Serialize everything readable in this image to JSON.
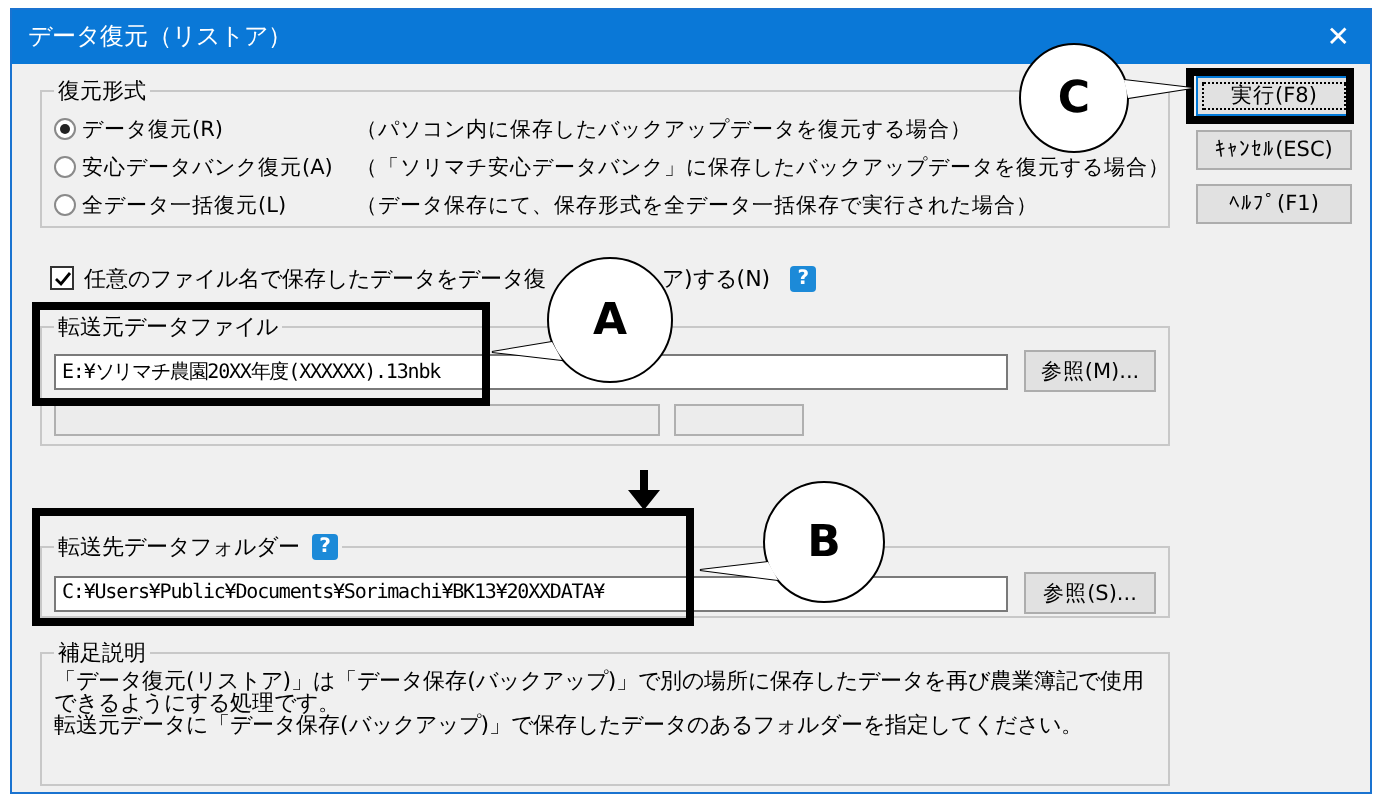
{
  "window": {
    "title": "データ復元（リストア）",
    "close": "✕"
  },
  "restore_mode": {
    "title": "復元形式",
    "options": [
      {
        "label": "データ復元(R)",
        "description": "（パソコン内に保存したバックアップデータを復元する場合）",
        "selected": true
      },
      {
        "label": "安心データバンク復元(A)",
        "description": "（「ソリマチ安心データバンク」に保存したバックアップデータを復元する場合）",
        "selected": false
      },
      {
        "label": "全データ一括復元(L)",
        "description": "（データ保存にて、保存形式を全データ一括保存で実行された場合）",
        "selected": false
      }
    ]
  },
  "buttons": [
    {
      "label": "実行(F8)",
      "focused": true
    },
    {
      "label": "ｷｬﾝｾﾙ(ESC)",
      "focused": false
    },
    {
      "label": "ﾍﾙﾌﾟ(F1)",
      "focused": false
    }
  ],
  "checkbox": {
    "label_parts": [
      "任意のファイル名で保存したデータをデータ復",
      "ア)する(N)"
    ],
    "checked": true,
    "help": "?"
  },
  "source": {
    "title": "転送元データファイル",
    "value": "E:¥ソリマチ農園20XX年度(XXXXXX).13nbk",
    "browse": "参照(M)..."
  },
  "destination": {
    "title": "転送先データフォルダー",
    "help": "?",
    "value": "C:¥Users¥Public¥Documents¥Sorimachi¥BK13¥20XXDATA¥",
    "browse": "参照(S)..."
  },
  "notes": {
    "title": "補足説明",
    "lines": [
      "「データ復元(リストア)」は「データ保存(バックアップ)」で別の場所に保存したデータを再び農業簿記で使用できるようにする処理です。",
      "転送元データに「データ保存(バックアップ)」で保存したデータのあるフォルダーを指定してください。"
    ]
  },
  "callouts": [
    {
      "label": "A"
    },
    {
      "label": "B"
    },
    {
      "label": "C"
    }
  ]
}
